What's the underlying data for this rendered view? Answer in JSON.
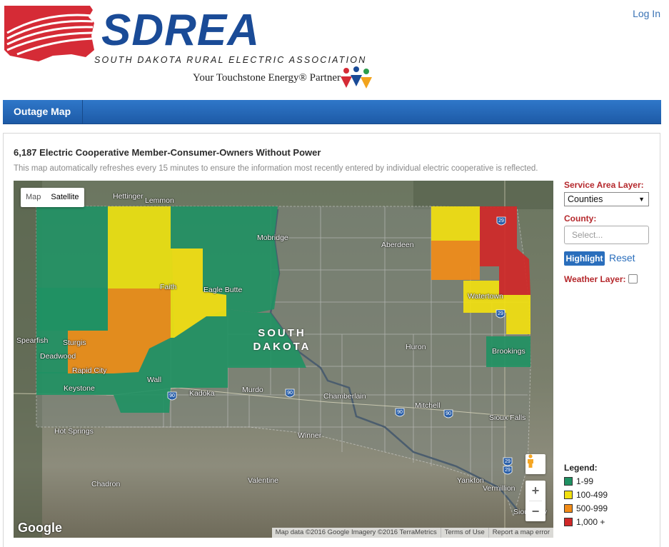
{
  "header": {
    "logo_word": "SDREA",
    "logo_subtitle": "SOUTH DAKOTA RURAL ELECTRIC ASSOCIATION",
    "partner_text": "Your Touchstone Energy® Partner",
    "login_label": "Log In"
  },
  "nav": {
    "items": [
      "Outage Map"
    ]
  },
  "content": {
    "title": "6,187 Electric Cooperative Member-Consumer-Owners Without Power",
    "subtitle": "This map automatically refreshes every 15 minutes to ensure the information most recently entered by individual electric cooperative is reflected."
  },
  "map": {
    "type_buttons": [
      "Map",
      "Satellite"
    ],
    "active_type": "Satellite",
    "state_label_line1": "SOUTH",
    "state_label_line2": "DAKOTA",
    "cities": [
      "Hettinger",
      "Lemmon",
      "Mobridge",
      "Aberdeen",
      "Faith",
      "Eagle Butte",
      "Watertown",
      "Spearfish",
      "Sturgis",
      "Deadwood",
      "Huron",
      "Brookings",
      "Rapid City",
      "Wall",
      "Keystone",
      "Kadoka",
      "Murdo",
      "Chamberlain",
      "Mitchell",
      "Sioux Falls",
      "Hot Springs",
      "Winner",
      "Chadron",
      "Valentine",
      "Yankton",
      "Vermillion",
      "Sioux City"
    ],
    "highways": [
      "29",
      "29",
      "90",
      "90",
      "90",
      "90",
      "29",
      "29"
    ],
    "zoom_in": "+",
    "zoom_out": "−",
    "google_label": "Google",
    "attribution": [
      "Map data ©2016 Google Imagery ©2016 TerraMetrics",
      "Terms of Use",
      "Report a map error"
    ],
    "icons": [
      "pegman-icon"
    ]
  },
  "sidebar": {
    "service_area_label": "Service Area Layer:",
    "service_area_value": "Counties",
    "county_label": "County:",
    "county_placeholder": "Select...",
    "highlight_label": "Highlight",
    "reset_label": "Reset",
    "weather_label": "Weather Layer:",
    "weather_checked": false
  },
  "legend": {
    "title": "Legend:",
    "items": [
      {
        "label": "1-99",
        "color": "#1f9163"
      },
      {
        "label": "100-499",
        "color": "#f2e010"
      },
      {
        "label": "500-999",
        "color": "#f28c18"
      },
      {
        "label": "1,000 +",
        "color": "#d02828"
      }
    ]
  }
}
